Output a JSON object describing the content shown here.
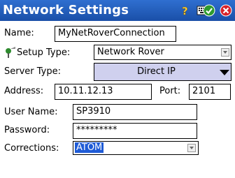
{
  "window": {
    "title": "Network Settings"
  },
  "titlebar_icons": {
    "help": "help-icon",
    "keyboard": "keyboard-icon",
    "ok": "ok-icon",
    "close": "close-icon"
  },
  "form": {
    "name_label": "Name:",
    "name_value": "MyNetRoverConnection",
    "setup_type_label": "Setup Type:",
    "setup_type_value": "Network Rover",
    "server_type_label": "Server Type:",
    "server_type_value": "Direct IP",
    "address_label": "Address:",
    "address_value": "10.11.12.13",
    "port_label": "Port:",
    "port_value": "2101",
    "username_label": "User Name:",
    "username_value": "SP3910",
    "password_label": "Password:",
    "password_value": "*********",
    "corrections_label": "Corrections:",
    "corrections_value": "ATOM"
  },
  "colors": {
    "titlebar": "#1f5bbf",
    "selection": "#1f5bd6",
    "server_dropdown": "#cfd0ee"
  }
}
